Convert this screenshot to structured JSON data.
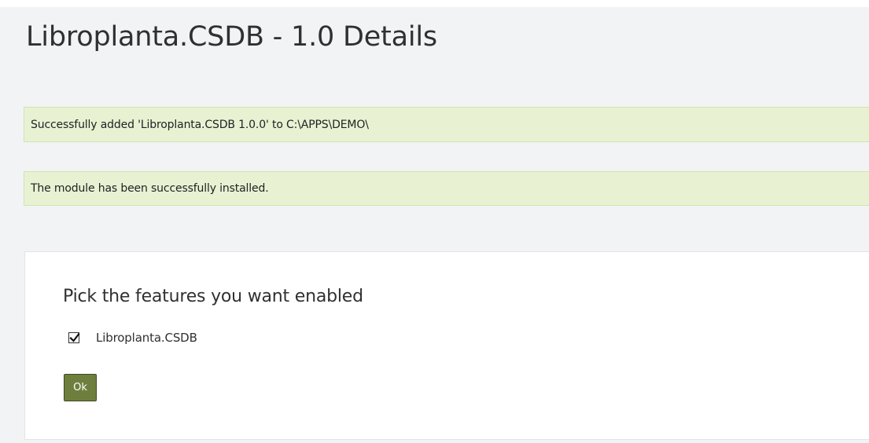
{
  "page": {
    "title": "Libroplanta.CSDB - 1.0 Details"
  },
  "alerts": [
    {
      "text": "Successfully added 'Libroplanta.CSDB 1.0.0' to C:\\APPS\\DEMO\\"
    },
    {
      "text": "The module has been successfully installed."
    }
  ],
  "features_panel": {
    "heading": "Pick the features you want enabled",
    "features": [
      {
        "label": "Libroplanta.CSDB",
        "checked": true
      }
    ],
    "ok_label": "Ok"
  },
  "colors": {
    "page_background": "#f2f3f5",
    "success_background": "#e8f2d3",
    "success_border": "#d2e3ae",
    "button_background": "#6e7f3d",
    "button_border": "#3f4a20"
  },
  "icons": {
    "checkbox_mark": "checkmark-icon"
  }
}
